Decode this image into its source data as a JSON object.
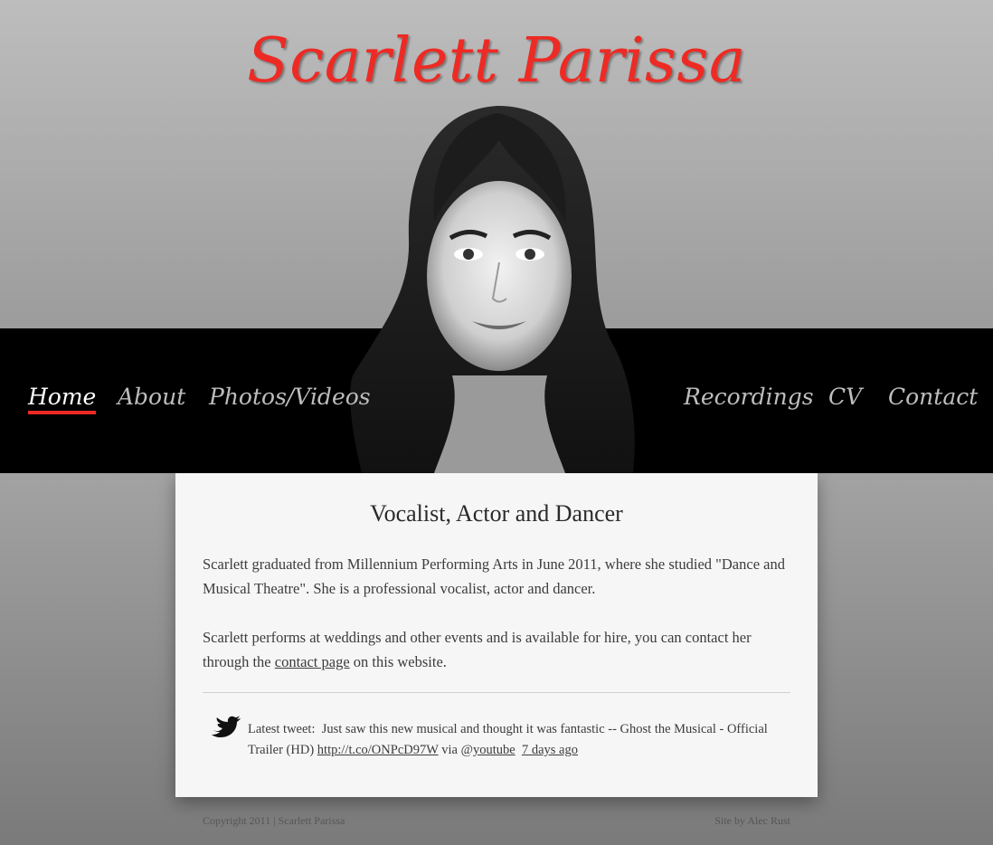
{
  "site": {
    "title": "Scarlett Parissa"
  },
  "nav": {
    "items": [
      {
        "label": "Home",
        "active": true
      },
      {
        "label": "About"
      },
      {
        "label": "Photos/Videos"
      },
      {
        "label": "Recordings"
      },
      {
        "label": "CV"
      },
      {
        "label": "Contact"
      }
    ]
  },
  "main": {
    "heading": "Vocalist, Actor and Dancer",
    "para1": "Scarlett graduated from Millennium Performing Arts in June 2011, where she studied \"Dance and Musical Theatre\". She is a professional vocalist, actor and dancer.",
    "para2_before": "Scarlett performs at weddings and other events and is available for hire, you can contact her through the ",
    "para2_link": "contact page",
    "para2_after": " on this website."
  },
  "tweet": {
    "label": "Latest tweet:",
    "text": "Just saw this new musical and thought it was fantastic -- Ghost the Musical - Official Trailer (HD)",
    "link": "http://t.co/ONPcD97W",
    "via": "via @",
    "handle": "youtube",
    "time": "7 days ago"
  },
  "footer": {
    "copyright": "Copyright 2011 | Scarlett Parissa",
    "credit": "Site by Alec Rust"
  },
  "colors": {
    "accent": "#ee2a24",
    "navbar": "#000000",
    "panel": "#f6f6f6"
  },
  "icons": {
    "tweet": "twitter-bird-icon"
  }
}
